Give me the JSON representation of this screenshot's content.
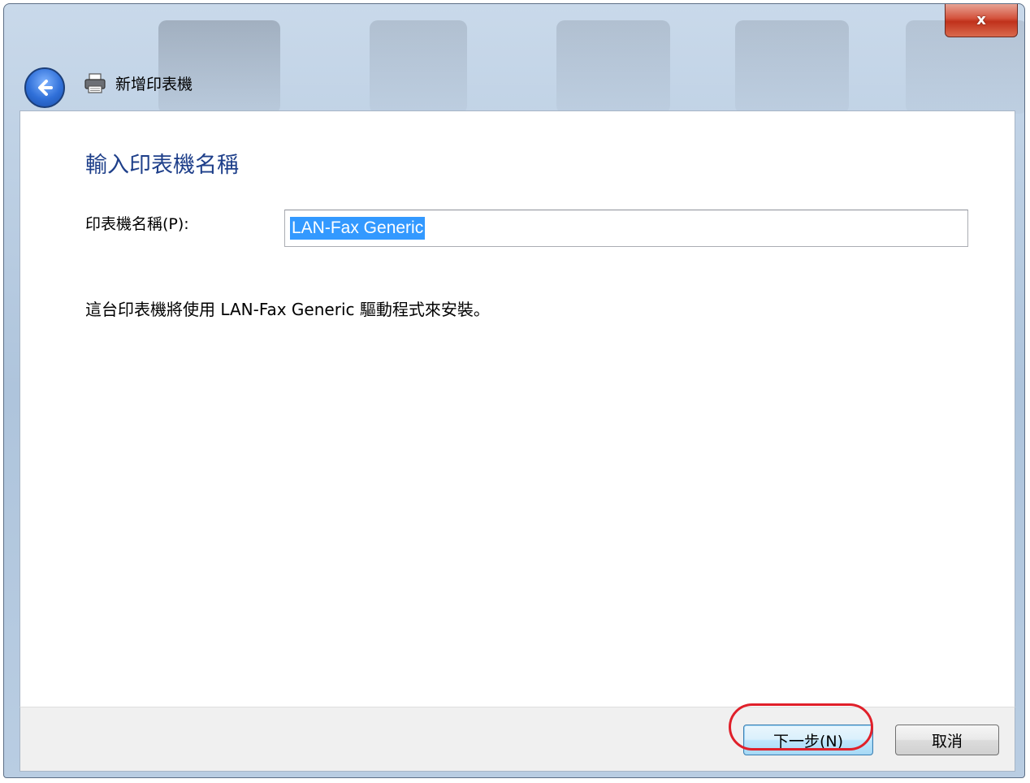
{
  "window": {
    "title": "新增印表機",
    "close_label": "x"
  },
  "page": {
    "heading": "輸入印表機名稱",
    "printer_name_label": "印表機名稱(P):",
    "printer_name_value": "LAN-Fax Generic",
    "info_text": "這台印表機將使用 LAN-Fax Generic 驅動程式來安裝。"
  },
  "footer": {
    "next_label": "下一步(N)",
    "cancel_label": "取消"
  },
  "colors": {
    "heading": "#1e3f8a",
    "selection": "#3399ff",
    "highlight_ring": "#e0202a"
  }
}
